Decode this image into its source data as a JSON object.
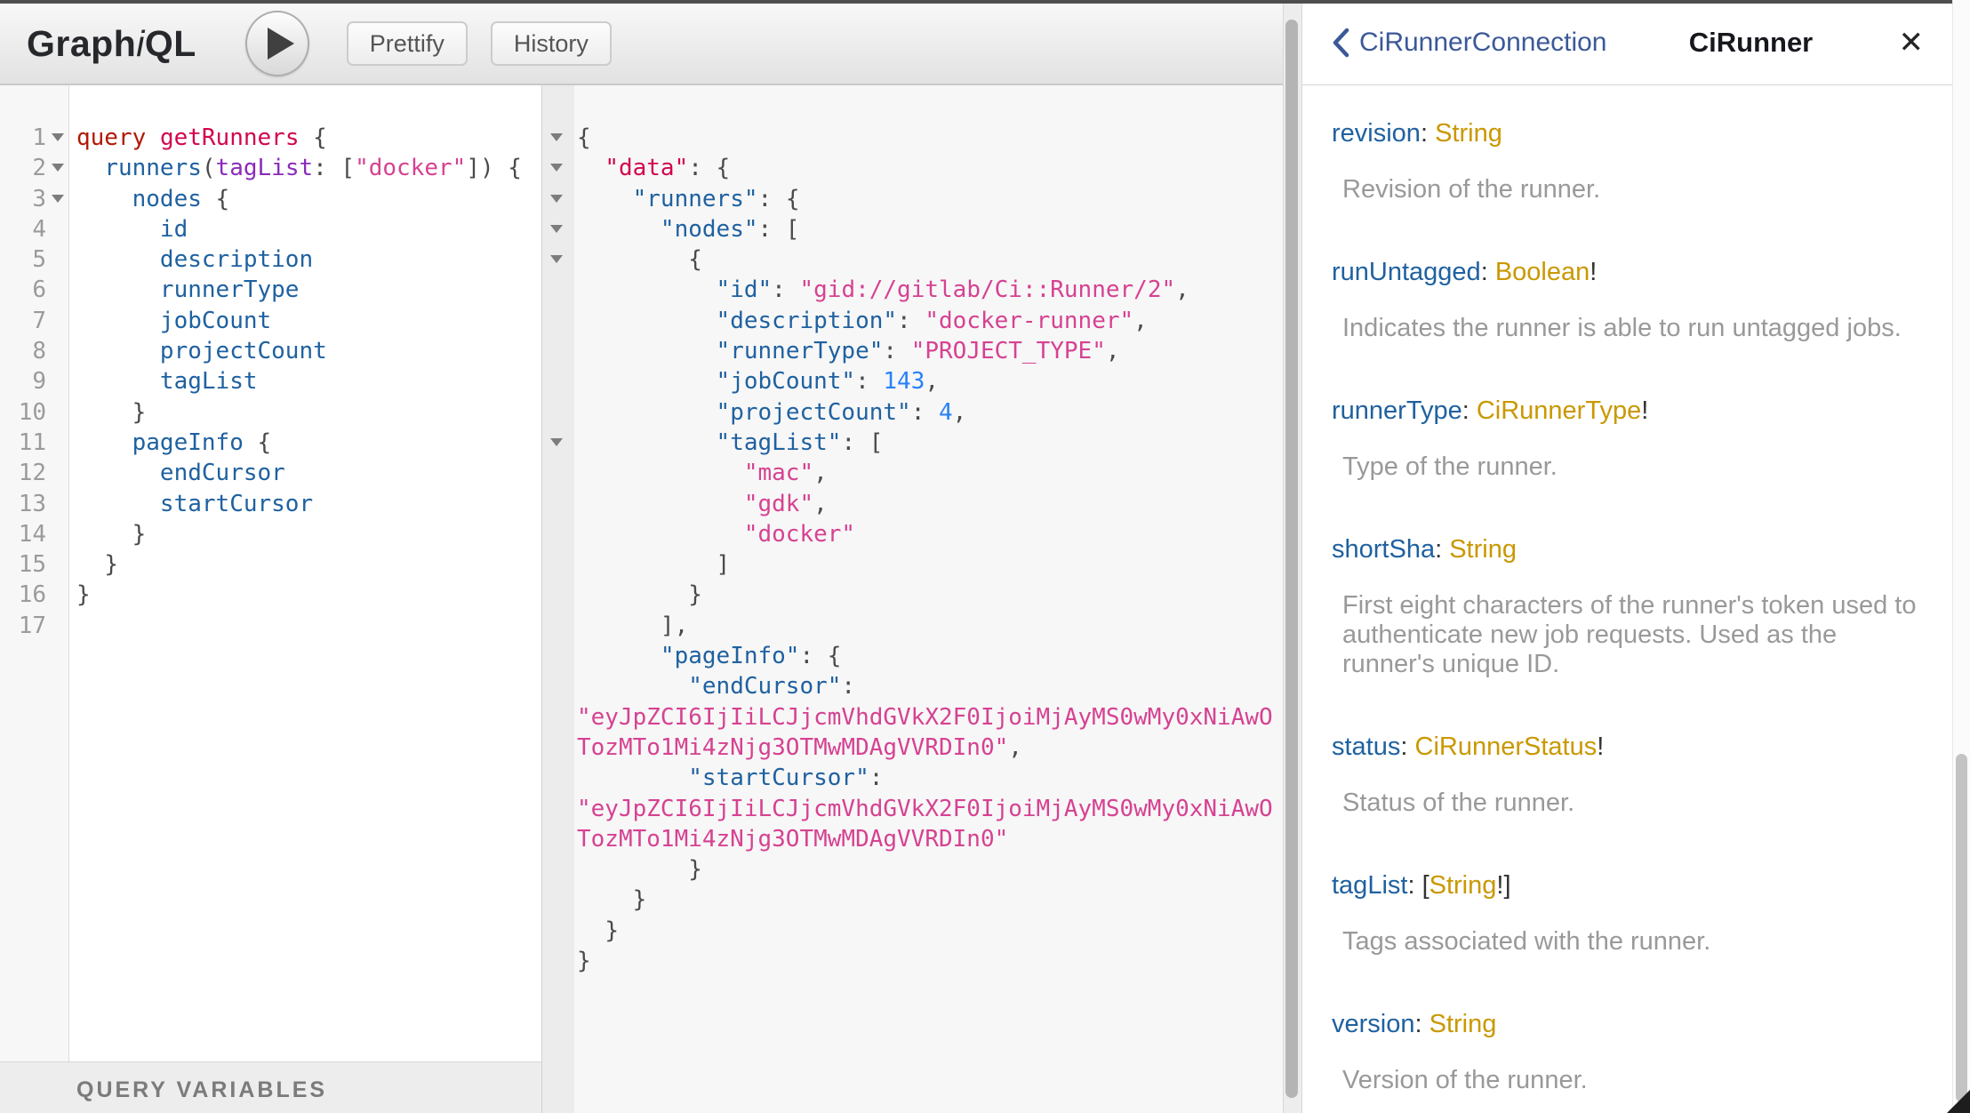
{
  "colors": {
    "keyword": "#B11A04",
    "definition": "#D2054E",
    "property": "#1F61A0",
    "attribute": "#8B2BB9",
    "string": "#D64292",
    "number": "#2882F9",
    "punctuation": "#4a4a4a",
    "doc_field_name": "#1F61A0",
    "doc_type_name": "#CA9800",
    "doc_description": "#999999",
    "doc_back_link": "#3B5998"
  },
  "toolbar": {
    "logo_pre": "Graph",
    "logo_i": "i",
    "logo_post": "QL",
    "play_icon": "play-triangle",
    "prettify_label": "Prettify",
    "history_label": "History"
  },
  "query_editor": {
    "lines": [
      {
        "num": "1",
        "fold": true,
        "indent": 0,
        "tokens": [
          [
            "kw",
            "query"
          ],
          [
            "pun",
            " "
          ],
          [
            "def",
            "getRunners"
          ],
          [
            "pun",
            " {"
          ]
        ]
      },
      {
        "num": "2",
        "fold": true,
        "indent": 2,
        "tokens": [
          [
            "prop",
            "runners"
          ],
          [
            "pun",
            "("
          ],
          [
            "attr",
            "tagList"
          ],
          [
            "pun",
            ": ["
          ],
          [
            "str",
            "\"docker\""
          ],
          [
            "pun",
            "]) {"
          ]
        ]
      },
      {
        "num": "3",
        "fold": true,
        "indent": 4,
        "tokens": [
          [
            "prop",
            "nodes"
          ],
          [
            "pun",
            " {"
          ]
        ]
      },
      {
        "num": "4",
        "fold": false,
        "indent": 6,
        "tokens": [
          [
            "prop",
            "id"
          ]
        ]
      },
      {
        "num": "5",
        "fold": false,
        "indent": 6,
        "tokens": [
          [
            "prop",
            "description"
          ]
        ]
      },
      {
        "num": "6",
        "fold": false,
        "indent": 6,
        "tokens": [
          [
            "prop",
            "runnerType"
          ]
        ]
      },
      {
        "num": "7",
        "fold": false,
        "indent": 6,
        "tokens": [
          [
            "prop",
            "jobCount"
          ]
        ]
      },
      {
        "num": "8",
        "fold": false,
        "indent": 6,
        "tokens": [
          [
            "prop",
            "projectCount"
          ]
        ]
      },
      {
        "num": "9",
        "fold": false,
        "indent": 6,
        "tokens": [
          [
            "prop",
            "tagList"
          ]
        ]
      },
      {
        "num": "10",
        "fold": false,
        "indent": 4,
        "tokens": [
          [
            "pun",
            "}"
          ]
        ]
      },
      {
        "num": "11",
        "fold": false,
        "indent": 4,
        "tokens": [
          [
            "prop",
            "pageInfo"
          ],
          [
            "pun",
            " {"
          ]
        ]
      },
      {
        "num": "12",
        "fold": false,
        "indent": 6,
        "tokens": [
          [
            "prop",
            "endCursor"
          ]
        ]
      },
      {
        "num": "13",
        "fold": false,
        "indent": 6,
        "tokens": [
          [
            "prop",
            "startCursor"
          ]
        ]
      },
      {
        "num": "14",
        "fold": false,
        "indent": 4,
        "tokens": [
          [
            "pun",
            "}"
          ]
        ]
      },
      {
        "num": "15",
        "fold": false,
        "indent": 2,
        "tokens": [
          [
            "pun",
            "}"
          ]
        ]
      },
      {
        "num": "16",
        "fold": false,
        "indent": 0,
        "tokens": [
          [
            "pun",
            "}"
          ]
        ]
      },
      {
        "num": "17",
        "fold": false,
        "indent": 0,
        "tokens": []
      }
    ]
  },
  "variables_panel": {
    "title": "QUERY VARIABLES"
  },
  "response_viewer": {
    "lines": [
      {
        "fold": true,
        "indent": 0,
        "tokens": [
          [
            "pun",
            "{"
          ]
        ]
      },
      {
        "fold": true,
        "indent": 2,
        "tokens": [
          [
            "def",
            "\"data\""
          ],
          [
            "pun",
            ": {"
          ]
        ]
      },
      {
        "fold": true,
        "indent": 4,
        "tokens": [
          [
            "prop",
            "\"runners\""
          ],
          [
            "pun",
            ": {"
          ]
        ]
      },
      {
        "fold": true,
        "indent": 6,
        "tokens": [
          [
            "prop",
            "\"nodes\""
          ],
          [
            "pun",
            ": ["
          ]
        ]
      },
      {
        "fold": true,
        "indent": 8,
        "tokens": [
          [
            "pun",
            "{"
          ]
        ]
      },
      {
        "fold": false,
        "indent": 10,
        "tokens": [
          [
            "prop",
            "\"id\""
          ],
          [
            "pun",
            ": "
          ],
          [
            "str",
            "\"gid://gitlab/Ci::Runner/2\""
          ],
          [
            "pun",
            ","
          ]
        ]
      },
      {
        "fold": false,
        "indent": 10,
        "tokens": [
          [
            "prop",
            "\"description\""
          ],
          [
            "pun",
            ": "
          ],
          [
            "str",
            "\"docker-runner\""
          ],
          [
            "pun",
            ","
          ]
        ]
      },
      {
        "fold": false,
        "indent": 10,
        "tokens": [
          [
            "prop",
            "\"runnerType\""
          ],
          [
            "pun",
            ": "
          ],
          [
            "str",
            "\"PROJECT_TYPE\""
          ],
          [
            "pun",
            ","
          ]
        ]
      },
      {
        "fold": false,
        "indent": 10,
        "tokens": [
          [
            "prop",
            "\"jobCount\""
          ],
          [
            "pun",
            ": "
          ],
          [
            "num",
            "143"
          ],
          [
            "pun",
            ","
          ]
        ]
      },
      {
        "fold": false,
        "indent": 10,
        "tokens": [
          [
            "prop",
            "\"projectCount\""
          ],
          [
            "pun",
            ": "
          ],
          [
            "num",
            "4"
          ],
          [
            "pun",
            ","
          ]
        ]
      },
      {
        "fold": true,
        "indent": 10,
        "tokens": [
          [
            "prop",
            "\"tagList\""
          ],
          [
            "pun",
            ": ["
          ]
        ]
      },
      {
        "fold": false,
        "indent": 12,
        "tokens": [
          [
            "str",
            "\"mac\""
          ],
          [
            "pun",
            ","
          ]
        ]
      },
      {
        "fold": false,
        "indent": 12,
        "tokens": [
          [
            "str",
            "\"gdk\""
          ],
          [
            "pun",
            ","
          ]
        ]
      },
      {
        "fold": false,
        "indent": 12,
        "tokens": [
          [
            "str",
            "\"docker\""
          ]
        ]
      },
      {
        "fold": false,
        "indent": 10,
        "tokens": [
          [
            "pun",
            "]"
          ]
        ]
      },
      {
        "fold": false,
        "indent": 8,
        "tokens": [
          [
            "pun",
            "}"
          ]
        ]
      },
      {
        "fold": false,
        "indent": 6,
        "tokens": [
          [
            "pun",
            "],"
          ]
        ]
      },
      {
        "fold": false,
        "indent": 6,
        "tokens": [
          [
            "prop",
            "\"pageInfo\""
          ],
          [
            "pun",
            ": {"
          ]
        ]
      },
      {
        "fold": false,
        "indent": 8,
        "tokens": [
          [
            "prop",
            "\"endCursor\""
          ],
          [
            "pun",
            ":"
          ]
        ]
      },
      {
        "fold": false,
        "indent": 0,
        "tokens": [
          [
            "str",
            "\"eyJpZCI6IjIiLCJjcmVhdGVkX2F0IjoiMjAyMS0wMy0xNiAwO"
          ]
        ]
      },
      {
        "fold": false,
        "indent": 0,
        "tokens": [
          [
            "str",
            "TozMTo1Mi4zNjg3OTMwMDAgVVJDSW4w"
          ],
          [
            "str",
            "\""
          ],
          [
            "pun",
            ","
          ]
        ]
      },
      {
        "fold": false,
        "indent": 8,
        "tokens": [
          [
            "prop",
            "\"startCursor\""
          ],
          [
            "pun",
            ":"
          ]
        ]
      },
      {
        "fold": false,
        "indent": 0,
        "tokens": [
          [
            "str",
            "\"eyJpZCI6IjIiLCJjcmVhdGVkX2F0IjoiMjAyMS0wMy0xNiAwO"
          ]
        ]
      },
      {
        "fold": false,
        "indent": 0,
        "tokens": [
          [
            "str",
            "TozMTo1Mi4zNjg3OTMwMDAgVVJDSW4w"
          ],
          [
            "str",
            "\""
          ]
        ]
      },
      {
        "fold": false,
        "indent": 8,
        "tokens": [
          [
            "pun",
            "}"
          ]
        ]
      },
      {
        "fold": false,
        "indent": 4,
        "tokens": [
          [
            "pun",
            "}"
          ]
        ]
      },
      {
        "fold": false,
        "indent": 2,
        "tokens": [
          [
            "pun",
            "}"
          ]
        ]
      },
      {
        "fold": false,
        "indent": 0,
        "tokens": [
          [
            "pun",
            "}"
          ]
        ]
      }
    ],
    "wrapped_cursor_line_1": "TozMTo1Mi4zNjg3OTMwMDAgVVRDIn0",
    "wrapped_cursor_line_2": "TozMTo1Mi4zNjg3OTMwMDAgVVRDIn0"
  },
  "doc_explorer": {
    "back_icon": "chevron-left",
    "back_label": "CiRunnerConnection",
    "title": "CiRunner",
    "close_icon": "✕",
    "fields": [
      {
        "sig": [
          [
            "fname",
            "revision"
          ],
          [
            "fpun",
            ": "
          ],
          [
            "ftype",
            "String"
          ]
        ],
        "desc": "Revision of the runner."
      },
      {
        "sig": [
          [
            "fname",
            "runUntagged"
          ],
          [
            "fpun",
            ": "
          ],
          [
            "ftype",
            "Boolean"
          ],
          [
            "fpun",
            "!"
          ]
        ],
        "desc": "Indicates the runner is able to run untagged jobs."
      },
      {
        "sig": [
          [
            "fname",
            "runnerType"
          ],
          [
            "fpun",
            ": "
          ],
          [
            "ftype",
            "CiRunnerType"
          ],
          [
            "fpun",
            "!"
          ]
        ],
        "desc": "Type of the runner."
      },
      {
        "sig": [
          [
            "fname",
            "shortSha"
          ],
          [
            "fpun",
            ": "
          ],
          [
            "ftype",
            "String"
          ]
        ],
        "desc": "First eight characters of the runner's token used to authenticate new job requests. Used as the runner's unique ID."
      },
      {
        "sig": [
          [
            "fname",
            "status"
          ],
          [
            "fpun",
            ": "
          ],
          [
            "ftype",
            "CiRunnerStatus"
          ],
          [
            "fpun",
            "!"
          ]
        ],
        "desc": "Status of the runner."
      },
      {
        "sig": [
          [
            "fname",
            "tagList"
          ],
          [
            "fpun",
            ": ["
          ],
          [
            "ftype",
            "String"
          ],
          [
            "fpun",
            "!]"
          ]
        ],
        "desc": "Tags associated with the runner."
      },
      {
        "sig": [
          [
            "fname",
            "version"
          ],
          [
            "fpun",
            ": "
          ],
          [
            "ftype",
            "String"
          ]
        ],
        "desc": "Version of the runner."
      }
    ]
  }
}
